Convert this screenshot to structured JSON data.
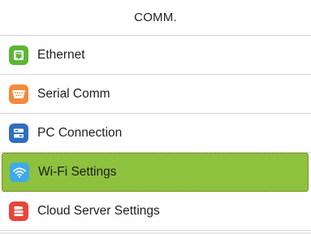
{
  "header": {
    "title": "COMM."
  },
  "menu": {
    "items": [
      {
        "label": "Ethernet",
        "icon": "ethernet-icon",
        "color": "#5db534",
        "selected": false
      },
      {
        "label": "Serial Comm",
        "icon": "serial-port-icon",
        "color": "#f58a3c",
        "selected": false
      },
      {
        "label": "PC Connection",
        "icon": "pc-connection-icon",
        "color": "#2f6fc0",
        "selected": false
      },
      {
        "label": "Wi-Fi Settings",
        "icon": "wifi-icon",
        "color": "#3fa9e8",
        "selected": true
      },
      {
        "label": "Cloud Server Settings",
        "icon": "cloud-server-icon",
        "color": "#e8453c",
        "selected": false
      }
    ]
  },
  "colors": {
    "selected_background": "#8dc13e",
    "selected_border": "#7a5b14"
  }
}
